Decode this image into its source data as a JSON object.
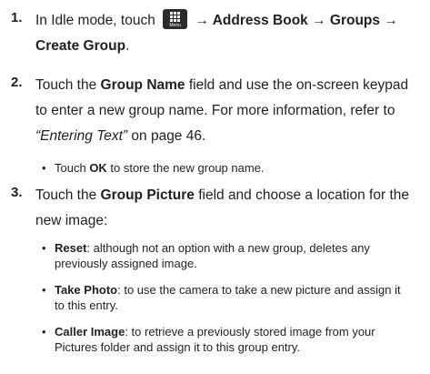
{
  "steps": [
    {
      "number": "1.",
      "line1_pre": "In Idle mode, touch",
      "line1_post": "→ Address Book → Groups →",
      "line2_bold": "Create Group",
      "line2_post": ".",
      "icon": {
        "name": "menu-grid-icon",
        "label": "Menu"
      }
    },
    {
      "number": "2.",
      "line1_pre": "Touch the ",
      "line1_bold": "Group Name",
      "line1_post": " field and use the on-screen keypad",
      "line2": "to enter a new group name. For more information, refer to",
      "line3_italic": "“Entering Text”",
      "line3_post": "  on page 46.",
      "sub_bullet_pre": "Touch ",
      "sub_bullet_bold": "OK",
      "sub_bullet_post": " to store the new group name."
    },
    {
      "number": "3.",
      "line1_pre": "Touch the ",
      "line1_bold": "Group Picture",
      "line1_post": " field and choose a location for the",
      "line2": "new image:",
      "bullets": [
        {
          "term": "Reset",
          "line1": ": although not an option with a new group, deletes any",
          "line2": "previously assigned image."
        },
        {
          "term": "Take Photo",
          "line1": ": to use the camera to take a new picture and assign it",
          "line2": "to this entry."
        },
        {
          "term": "Caller Image",
          "line1": ": to retrieve a previously stored image from your",
          "line2": "Pictures folder and assign it to this group entry."
        }
      ]
    }
  ]
}
